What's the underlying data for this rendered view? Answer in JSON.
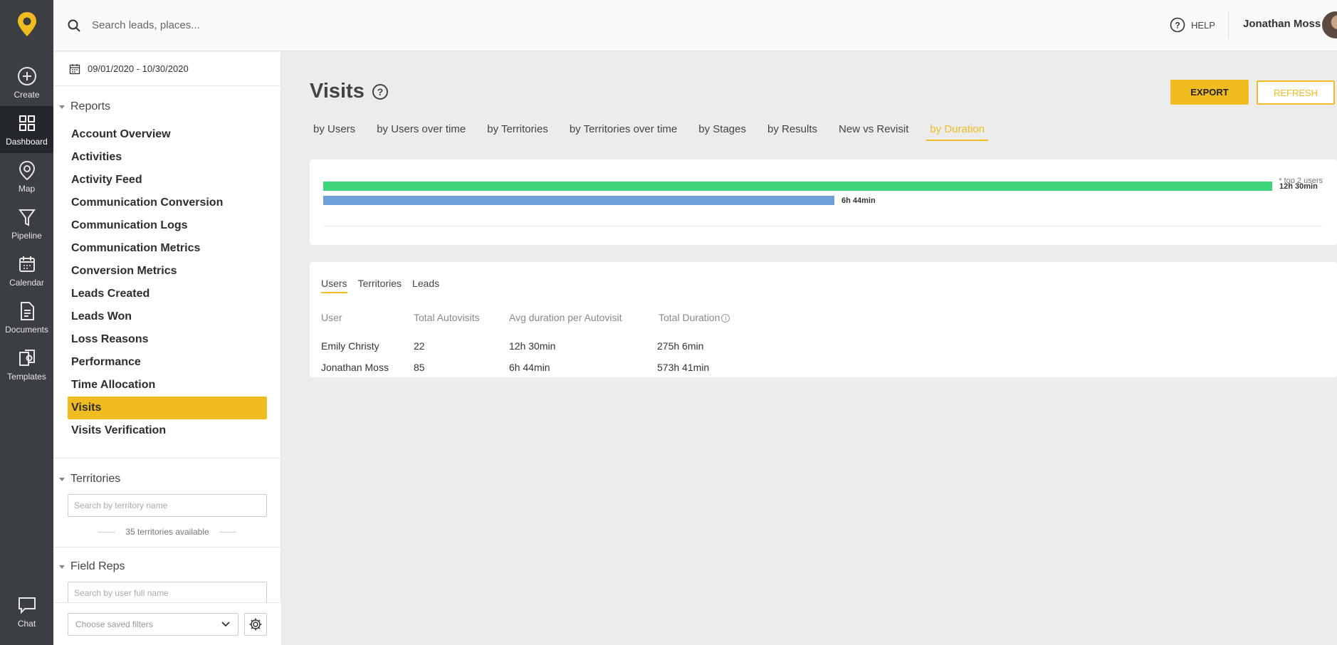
{
  "rail": {
    "items": [
      {
        "label": "Create"
      },
      {
        "label": "Dashboard"
      },
      {
        "label": "Map"
      },
      {
        "label": "Pipeline"
      },
      {
        "label": "Calendar"
      },
      {
        "label": "Documents"
      },
      {
        "label": "Templates"
      }
    ],
    "chat_label": "Chat"
  },
  "topbar": {
    "search_placeholder": "Search leads, places...",
    "help_label": "HELP",
    "user_name": "Jonathan Moss"
  },
  "sidebar": {
    "date_range": "09/01/2020 - 10/30/2020",
    "reports_title": "Reports",
    "reports": [
      "Account Overview",
      "Activities",
      "Activity Feed",
      "Communication Conversion",
      "Communication Logs",
      "Communication Metrics",
      "Conversion Metrics",
      "Leads Created",
      "Leads Won",
      "Loss Reasons",
      "Performance",
      "Time Allocation",
      "Visits",
      "Visits Verification"
    ],
    "active_report": "Visits",
    "territories_title": "Territories",
    "territory_search_placeholder": "Search by territory name",
    "territories_available": "35 territories available",
    "field_reps_title": "Field Reps",
    "user_search_placeholder": "Search by user full name",
    "saved_filters_placeholder": "Choose saved filters"
  },
  "main": {
    "title": "Visits",
    "export_label": "EXPORT",
    "refresh_label": "REFRESH",
    "tabs": [
      "by Users",
      "by Users over time",
      "by Territories",
      "by Territories over time",
      "by Stages",
      "by Results",
      "New vs Revisit",
      "by Duration"
    ],
    "active_tab": "by Duration",
    "chart_note": "* top 2 users",
    "subtabs": [
      "Users",
      "Territories",
      "Leads"
    ],
    "active_subtab": "Users",
    "table": {
      "headers": [
        "User",
        "Total Autovisits",
        "Avg duration per Autovisit",
        "Total Duration"
      ],
      "rows": [
        [
          "Emily Christy",
          "22",
          "12h 30min",
          "275h 6min"
        ],
        [
          "Jonathan Moss",
          "85",
          "6h 44min",
          "573h 41min"
        ]
      ]
    }
  },
  "colors": {
    "accent": "#f0bc20",
    "bar_1": "#3ed47a",
    "bar_2": "#6f9fd8",
    "rail_bg": "#3b3e43"
  },
  "chart_data": {
    "type": "bar",
    "orientation": "horizontal",
    "categories": [
      "Emily Christy",
      "Jonathan Moss"
    ],
    "values": [
      750,
      404
    ],
    "unit": "minutes",
    "data_labels": [
      "12h 30min",
      "6h 44min"
    ],
    "note": "* top 2 users"
  }
}
